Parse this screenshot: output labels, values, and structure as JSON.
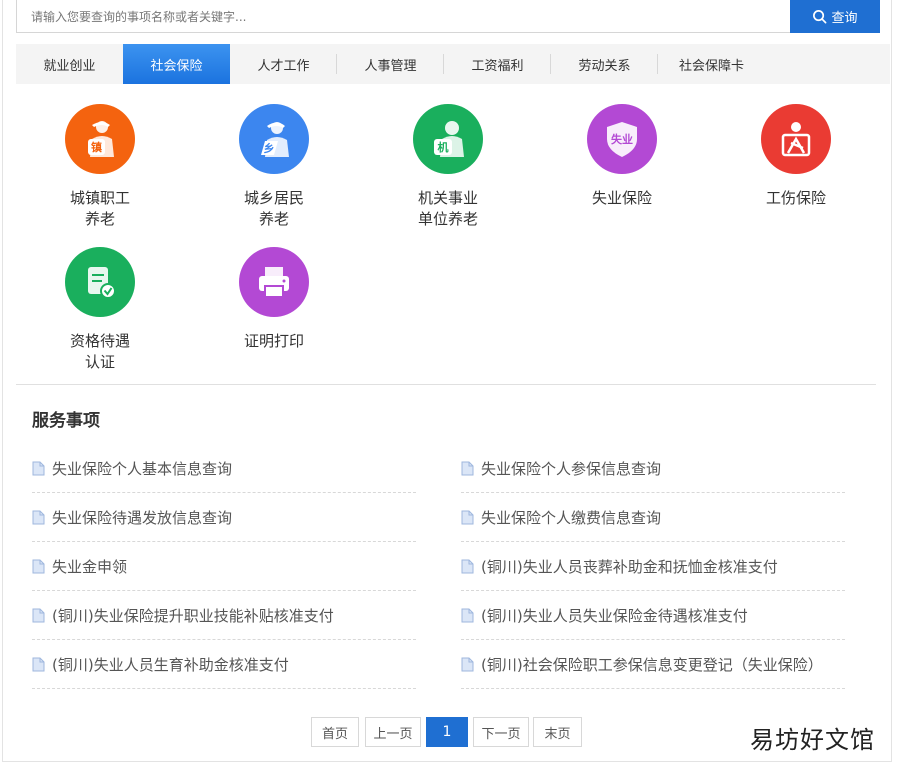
{
  "search": {
    "placeholder": "请输入您要查询的事项名称或者关键字...",
    "button_label": "查询"
  },
  "tabs": [
    {
      "label": "就业创业",
      "active": false
    },
    {
      "label": "社会保险",
      "active": true
    },
    {
      "label": "人才工作",
      "active": false
    },
    {
      "label": "人事管理",
      "active": false
    },
    {
      "label": "工资福利",
      "active": false
    },
    {
      "label": "劳动关系",
      "active": false
    },
    {
      "label": "社会保障卡",
      "active": false
    }
  ],
  "categories": [
    {
      "label": "城镇职工\n养老",
      "glyph": "镇",
      "icon": "urban-worker-pension-icon",
      "color": "#f4630f"
    },
    {
      "label": "城乡居民\n养老",
      "glyph": "乡",
      "icon": "resident-pension-icon",
      "color": "#3c86ef"
    },
    {
      "label": "机关事业\n单位养老",
      "glyph": "机",
      "icon": "institution-pension-icon",
      "color": "#1aaf5d"
    },
    {
      "label": "失业保险",
      "glyph": "失业",
      "icon": "unemployment-insurance-icon",
      "color": "#b349d4"
    },
    {
      "label": "工伤保险",
      "glyph": "",
      "icon": "injury-insurance-icon",
      "color": "#ea3b33"
    },
    {
      "label": "资格待遇\n认证",
      "glyph": "",
      "icon": "qualification-certification-icon",
      "color": "#1aaf5d"
    },
    {
      "label": "证明打印",
      "glyph": "",
      "icon": "printer-icon",
      "color": "#b349d4"
    }
  ],
  "services_title": "服务事项",
  "services": [
    "失业保险个人基本信息查询",
    "失业保险个人参保信息查询",
    "失业保险待遇发放信息查询",
    "失业保险个人缴费信息查询",
    "失业金申领",
    "(铜川)失业人员丧葬补助金和抚恤金核准支付",
    "(铜川)失业保险提升职业技能补贴核准支付",
    "(铜川)失业人员失业保险金待遇核准支付",
    "(铜川)失业人员生育补助金核准支付",
    "(铜川)社会保险职工参保信息变更登记（失业保险）"
  ],
  "pagination": {
    "first": "首页",
    "prev": "上一页",
    "current": "1",
    "next": "下一页",
    "last": "末页"
  },
  "watermark": "易坊好文馆"
}
